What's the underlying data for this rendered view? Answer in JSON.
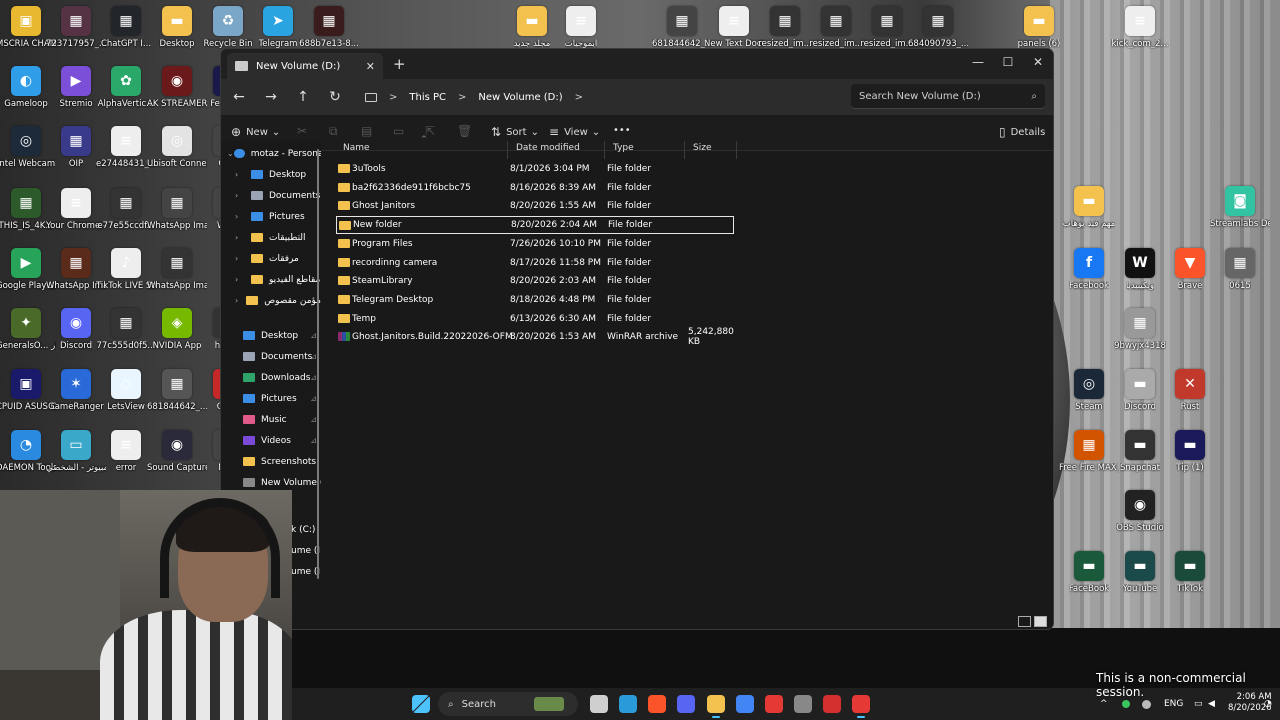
{
  "desktop_icons": [
    {
      "label": "MSCRIA CHAMELEON",
      "color": "#e8b830",
      "glyph": "▣"
    },
    {
      "label": "723717957_...",
      "color": "#553344",
      "glyph": "▦"
    },
    {
      "label": "ChatGPT I...",
      "color": "#22252a",
      "glyph": "▦"
    },
    {
      "label": "Desktop",
      "color": "#f2c14e",
      "glyph": "▬"
    },
    {
      "label": "Recycle Bin",
      "color": "#7aa7c7",
      "glyph": "♻"
    },
    {
      "label": "Telegram",
      "color": "#2aa4e0",
      "glyph": "➤"
    },
    {
      "label": "688b7e13-8...",
      "color": "#3a1c1c",
      "glyph": "▦"
    },
    {
      "label": "مجلد جديد",
      "color": "#f2c14e",
      "glyph": "▬"
    },
    {
      "label": "ايموجيات",
      "color": "#eeeeee",
      "glyph": "≡"
    },
    {
      "label": "681844642_...",
      "color": "#444",
      "glyph": "▦"
    },
    {
      "label": "New Text Document",
      "color": "#eeeeee",
      "glyph": "≡"
    },
    {
      "label": "resized_im...",
      "color": "#333",
      "glyph": "▦"
    },
    {
      "label": "resized_im...",
      "color": "#333",
      "glyph": "▦"
    },
    {
      "label": "resized_im...",
      "color": "#333",
      "glyph": "▦"
    },
    {
      "label": "684090793_...",
      "color": "#333",
      "glyph": "▦"
    },
    {
      "label": "panels (6)",
      "color": "#f2c14e",
      "glyph": "▬"
    },
    {
      "label": "kick_com_2...",
      "color": "#eeeeee",
      "glyph": "≡"
    },
    {
      "label": "Gameloop",
      "color": "#2f9de8",
      "glyph": "◐"
    },
    {
      "label": "Stremio",
      "color": "#7b4fd8",
      "glyph": "▶"
    },
    {
      "label": "AlphaVertic...",
      "color": "#2aa86a",
      "glyph": "✿"
    },
    {
      "label": "AK STREAMERS",
      "color": "#6a1a1a",
      "glyph": "◉"
    },
    {
      "label": "Fe Lea...",
      "color": "#1a1a4a",
      "glyph": "▦"
    },
    {
      "label": "Intel Webcam",
      "color": "#1d2a3a",
      "glyph": "◎"
    },
    {
      "label": "OIP",
      "color": "#3a3a8a",
      "glyph": "▦"
    },
    {
      "label": "e27448431_...",
      "color": "#eeeeee",
      "glyph": "≡"
    },
    {
      "label": "Ubisoft Connect",
      "color": "#e3e3e3",
      "glyph": "◎"
    },
    {
      "label": "Ca...",
      "color": "#444",
      "glyph": "▦"
    },
    {
      "label": "THIS_IS_4K...",
      "color": "#2d5a2a",
      "glyph": "▦"
    },
    {
      "label": "Your Chrome - Chrome",
      "color": "#eeeeee",
      "glyph": "≡"
    },
    {
      "label": "e77e55ccdf...",
      "color": "#333",
      "glyph": "▦"
    },
    {
      "label": "WhatsApp Image 2026...",
      "color": "#444",
      "glyph": "▦"
    },
    {
      "label": "Wh...",
      "color": "#444",
      "glyph": "▦"
    },
    {
      "label": "Google Play الـ",
      "color": "#27a35a",
      "glyph": "▶"
    },
    {
      "label": "WhatsApp Image 2026...",
      "color": "#5a2a1a",
      "glyph": "▦"
    },
    {
      "label": "TikTok LIVE Studio",
      "color": "#eeeeee",
      "glyph": "♪"
    },
    {
      "label": "WhatsApp Image 2026...",
      "color": "#333",
      "glyph": "▦"
    },
    {
      "label": "GeneralsO... اختصار -",
      "color": "#4a6a2a",
      "glyph": "✦"
    },
    {
      "label": "Discord",
      "color": "#5865f2",
      "glyph": "◉"
    },
    {
      "label": "77c555d0f5...",
      "color": "#333",
      "glyph": "▦"
    },
    {
      "label": "NVIDIA App",
      "color": "#76b900",
      "glyph": "◈"
    },
    {
      "label": "hide...",
      "color": "#333",
      "glyph": "▦"
    },
    {
      "label": "CPUID ASUS CPU-Z",
      "color": "#1a1a6a",
      "glyph": "▣"
    },
    {
      "label": "GameRanger",
      "color": "#2a6ad8",
      "glyph": "✶"
    },
    {
      "label": "LetsView",
      "color": "#eaf6ff",
      "glyph": "◇"
    },
    {
      "label": "681844642_...",
      "color": "#555",
      "glyph": "▦"
    },
    {
      "label": "C B...",
      "color": "#c62828",
      "glyph": "▦"
    },
    {
      "label": "DAEMON Tools Lite",
      "color": "#2a8ae0",
      "glyph": "◔"
    },
    {
      "label": "هذا الكمبيوتر - الشخصي ...",
      "color": "#3aa8c8",
      "glyph": "▭"
    },
    {
      "label": "error",
      "color": "#eeeeee",
      "glyph": "≡"
    },
    {
      "label": "Sound Capture",
      "color": "#2a2a3a",
      "glyph": "◉"
    },
    {
      "label": "Ne...",
      "color": "#444",
      "glyph": "▦"
    },
    {
      "label": "مهم فيد يوهات",
      "color": "#f2c14e",
      "glyph": "▬"
    },
    {
      "label": "Streamlabs Desktop",
      "color": "#31c3a2",
      "glyph": "◙"
    },
    {
      "label": "Facebook",
      "color": "#1877f2",
      "glyph": "f"
    },
    {
      "label": "ويكيبيديا",
      "color": "#111",
      "glyph": "W"
    },
    {
      "label": "Brave",
      "color": "#fb542b",
      "glyph": "▼"
    },
    {
      "label": "0615",
      "color": "#666",
      "glyph": "▦"
    },
    {
      "label": "9bwyjx4318",
      "color": "#999",
      "glyph": "▦"
    },
    {
      "label": "Steam",
      "color": "#1b2838",
      "glyph": "◎"
    },
    {
      "label": "Discord",
      "color": "#aaa",
      "glyph": "▬"
    },
    {
      "label": "Rust",
      "color": "#c0392b",
      "glyph": "✕"
    },
    {
      "label": "Free Fire MAX متجر",
      "color": "#d35400",
      "glyph": "▦"
    },
    {
      "label": "Snapchat",
      "color": "#333",
      "glyph": "▬"
    },
    {
      "label": "Tip (1)",
      "color": "#1a1a5a",
      "glyph": "▬"
    },
    {
      "label": "OBS Studio",
      "color": "#222",
      "glyph": "◉"
    },
    {
      "label": "FaceBook",
      "color": "#1a5a3a",
      "glyph": "▬"
    },
    {
      "label": "YouTube",
      "color": "#1a4a4a",
      "glyph": "▬"
    },
    {
      "label": "TikTok",
      "color": "#1a4a3a",
      "glyph": "▬"
    }
  ],
  "window": {
    "tab_title": "New Volume (D:)",
    "tab_close": "✕",
    "new_tab": "+",
    "controls": {
      "minimize": "—",
      "maximize": "☐",
      "close": "✕"
    }
  },
  "address_bar": {
    "back": "←",
    "forward": "→",
    "up": "↑",
    "refresh": "↻",
    "breadcrumb": [
      "This PC",
      "New Volume (D:)"
    ],
    "separator": ">",
    "search_placeholder": "Search New Volume (D:)",
    "search_icon": "⌕"
  },
  "toolbar": {
    "new_label": "New",
    "new_icon": "⊕",
    "sort_label": "Sort",
    "sort_icon": "⇅",
    "view_label": "View",
    "view_icon": "≡",
    "more_label": "•••",
    "details_label": "Details",
    "details_icon": "▯",
    "dropdown_icon": "⌄"
  },
  "nav_pane": {
    "top_item": "motaz - Persona",
    "tree": [
      {
        "label": "Desktop",
        "icon": "desktop",
        "color": "#3a8ee6"
      },
      {
        "label": "Documents",
        "icon": "documents",
        "color": "#9aa4b4"
      },
      {
        "label": "Pictures",
        "icon": "pictures",
        "color": "#3a8ee6"
      },
      {
        "label": "التطبيقات",
        "icon": "folder",
        "color": "#f2c14e"
      },
      {
        "label": "مرفقات",
        "icon": "folder",
        "color": "#f2c14e"
      },
      {
        "label": "مقاطع الفيديو",
        "icon": "folder",
        "color": "#f2c14e"
      },
      {
        "label": "مؤمن مقصوص",
        "icon": "folder",
        "color": "#f2c14e"
      }
    ],
    "quick_access": [
      {
        "label": "Desktop",
        "color": "#3a8ee6",
        "pinned": true
      },
      {
        "label": "Documents",
        "color": "#9aa4b4",
        "pinned": true
      },
      {
        "label": "Downloads",
        "color": "#2ea36a",
        "pinned": true
      },
      {
        "label": "Pictures",
        "color": "#3a8ee6",
        "pinned": true
      },
      {
        "label": "Music",
        "color": "#e05a8a",
        "pinned": true
      },
      {
        "label": "Videos",
        "color": "#7a4ad8",
        "pinned": true
      },
      {
        "label": "Screenshots",
        "color": "#f2c14e",
        "pinned": false
      },
      {
        "label": "New Volume (D:",
        "color": "#888",
        "pinned": false
      }
    ],
    "drives_partial": [
      "k (C:)",
      "ume (I",
      "ume (I"
    ],
    "pin_glyph": "📌"
  },
  "columns": {
    "name": "Name",
    "date": "Date modified",
    "type": "Type",
    "size": "Size"
  },
  "files": [
    {
      "name": "3uTools",
      "date": "8/1/2026 3:04 PM",
      "type": "File folder",
      "size": "",
      "kind": "folder"
    },
    {
      "name": "ba2f62336de911f6bcbc75",
      "date": "8/16/2026 8:39 AM",
      "type": "File folder",
      "size": "",
      "kind": "folder"
    },
    {
      "name": "Ghost Janitors",
      "date": "8/20/2026 1:55 AM",
      "type": "File folder",
      "size": "",
      "kind": "folder"
    },
    {
      "name": "New folder",
      "date": "8/20/2026 2:04 AM",
      "type": "File folder",
      "size": "",
      "kind": "folder",
      "selected": true
    },
    {
      "name": "Program Files",
      "date": "7/26/2026 10:10 PM",
      "type": "File folder",
      "size": "",
      "kind": "folder"
    },
    {
      "name": "recordinng camera",
      "date": "8/17/2026 11:58 PM",
      "type": "File folder",
      "size": "",
      "kind": "folder"
    },
    {
      "name": "SteamLibrary",
      "date": "8/20/2026 2:03 AM",
      "type": "File folder",
      "size": "",
      "kind": "folder"
    },
    {
      "name": "Telegram Desktop",
      "date": "8/18/2026 4:48 PM",
      "type": "File folder",
      "size": "",
      "kind": "folder"
    },
    {
      "name": "Temp",
      "date": "6/13/2026 6:30 AM",
      "type": "File folder",
      "size": "",
      "kind": "folder"
    },
    {
      "name": "Ghost.Janitors.Build.22022026-OFME.part1",
      "date": "8/20/2026 1:53 AM",
      "type": "WinRAR archive",
      "size": "5,242,880 KB",
      "kind": "rar"
    }
  ],
  "taskbar": {
    "search_placeholder": "Search",
    "search_icon": "⌕",
    "apps": [
      {
        "name": "start",
        "color": "#4cc2ff"
      },
      {
        "name": "task-view",
        "color": "#cfcfcf"
      },
      {
        "name": "edge",
        "color": "#2a9ad8"
      },
      {
        "name": "brave",
        "color": "#fb542b"
      },
      {
        "name": "discord",
        "color": "#5865f2"
      },
      {
        "name": "file-explorer",
        "color": "#f2c14e",
        "active": true
      },
      {
        "name": "chrome",
        "color": "#4285f4"
      },
      {
        "name": "app-red",
        "color": "#e53935"
      },
      {
        "name": "steam-like",
        "color": "#888"
      },
      {
        "name": "app-red-2",
        "color": "#d32f2f"
      },
      {
        "name": "recorder",
        "color": "#e53935",
        "active": true
      }
    ],
    "tray_up": "^",
    "lang": "ENG",
    "time": "2:06 AM",
    "date": "8/20/2026"
  },
  "overlay_text": "This is a non-commercial session."
}
